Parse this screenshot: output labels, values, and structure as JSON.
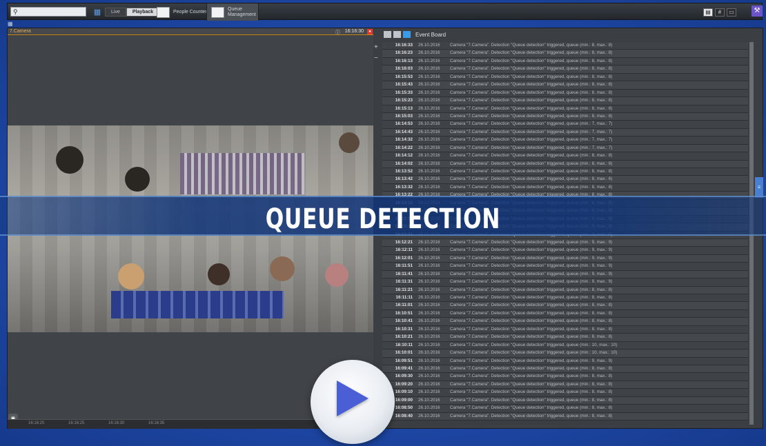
{
  "toolbar": {
    "search_placeholder": "",
    "mode_live": "Live",
    "mode_playback": "Playback",
    "people_counter": "People Counter",
    "queue_management": "Queue Management"
  },
  "camera": {
    "name": "7.Camera",
    "time": "16:16:30",
    "timeline_ticks": [
      "16:16:20",
      "16:16:25",
      "16:16:30",
      "16:16:35"
    ]
  },
  "event_board": {
    "title": "Event Board",
    "rows": [
      {
        "time": "16:16:33",
        "date": "26.10.2016",
        "message": "Camera \"7.Camera\". Detection \"Queue detection\" triggered, queue (min.: 8, max.: 8)"
      },
      {
        "time": "16:16:23",
        "date": "26.10.2016",
        "message": "Camera \"7.Camera\". Detection \"Queue detection\" triggered, queue (min.: 8, max.: 8)"
      },
      {
        "time": "16:16:13",
        "date": "26.10.2016",
        "message": "Camera \"7.Camera\". Detection \"Queue detection\" triggered, queue (min.: 8, max.: 8)"
      },
      {
        "time": "16:16:03",
        "date": "26.10.2016",
        "message": "Camera \"7.Camera\". Detection \"Queue detection\" triggered, queue (min.: 8, max.: 8)"
      },
      {
        "time": "16:15:53",
        "date": "26.10.2016",
        "message": "Camera \"7.Camera\". Detection \"Queue detection\" triggered, queue (min.: 8, max.: 8)"
      },
      {
        "time": "16:15:43",
        "date": "26.10.2016",
        "message": "Camera \"7.Camera\". Detection \"Queue detection\" triggered, queue (min.: 8, max.: 8)"
      },
      {
        "time": "16:15:33",
        "date": "26.10.2016",
        "message": "Camera \"7.Camera\". Detection \"Queue detection\" triggered, queue (min.: 8, max.: 8)"
      },
      {
        "time": "16:15:23",
        "date": "26.10.2016",
        "message": "Camera \"7.Camera\". Detection \"Queue detection\" triggered, queue (min.: 8, max.: 8)"
      },
      {
        "time": "16:15:13",
        "date": "26.10.2016",
        "message": "Camera \"7.Camera\". Detection \"Queue detection\" triggered, queue (min.: 8, max.: 8)"
      },
      {
        "time": "16:15:03",
        "date": "26.10.2016",
        "message": "Camera \"7.Camera\". Detection \"Queue detection\" triggered, queue (min.: 8, max.: 8)"
      },
      {
        "time": "16:14:53",
        "date": "26.10.2016",
        "message": "Camera \"7.Camera\". Detection \"Queue detection\" triggered, queue (min.: 7, max.: 7)"
      },
      {
        "time": "16:14:43",
        "date": "26.10.2016",
        "message": "Camera \"7.Camera\". Detection \"Queue detection\" triggered, queue (min.: 7, max.: 7)"
      },
      {
        "time": "16:14:32",
        "date": "26.10.2016",
        "message": "Camera \"7.Camera\". Detection \"Queue detection\" triggered, queue (min.: 7, max.: 7)"
      },
      {
        "time": "16:14:22",
        "date": "26.10.2016",
        "message": "Camera \"7.Camera\". Detection \"Queue detection\" triggered, queue (min.: 7, max.: 7)"
      },
      {
        "time": "16:14:12",
        "date": "26.10.2016",
        "message": "Camera \"7.Camera\". Detection \"Queue detection\" triggered, queue (min.: 8, max.: 8)"
      },
      {
        "time": "16:14:02",
        "date": "26.10.2016",
        "message": "Camera \"7.Camera\". Detection \"Queue detection\" triggered, queue (min.: 8, max.: 8)"
      },
      {
        "time": "16:13:52",
        "date": "26.10.2016",
        "message": "Camera \"7.Camera\". Detection \"Queue detection\" triggered, queue (min.: 8, max.: 8)"
      },
      {
        "time": "16:13:42",
        "date": "26.10.2016",
        "message": "Camera \"7.Camera\". Detection \"Queue detection\" triggered, queue (min.: 8, max.: 6)"
      },
      {
        "time": "16:13:32",
        "date": "26.10.2016",
        "message": "Camera \"7.Camera\". Detection \"Queue detection\" triggered, queue (min.: 8, max.: 8)"
      },
      {
        "time": "16:13:22",
        "date": "26.10.2016",
        "message": "Camera \"7.Camera\". Detection \"Queue detection\" triggered, queue (min.: 8, max.: 8)"
      },
      {
        "time": "16:13:12",
        "date": "26.10.2016",
        "message": "Camera \"7.Camera\". Detection \"Queue detection\" triggered, queue (min.: 8, max.: 8)"
      },
      {
        "time": "16:13:02",
        "date": "26.10.2016",
        "message": "Camera \"7.Camera\". Detection \"Queue detection\" triggered, queue (min.: 8, max.: 8)"
      },
      {
        "time": "16:12:51",
        "date": "26.10.2016",
        "message": "Camera \"7.Camera\". Detection \"Queue detection\" triggered, queue (min.: 8, max.: 8)"
      },
      {
        "time": "16:12:41",
        "date": "26.10.2016",
        "message": "Camera \"7.Camera\". Detection \"Queue detection\" triggered, queue (min.: 9, max.: 9)"
      },
      {
        "time": "16:12:31",
        "date": "26.10.2016",
        "message": "Camera \"7.Camera\". Detection \"Queue detection\" triggered, queue (min.: 9, max.: 9)"
      },
      {
        "time": "16:12:21",
        "date": "26.10.2016",
        "message": "Camera \"7.Camera\". Detection \"Queue detection\" triggered, queue (min.: 9, max.: 9)"
      },
      {
        "time": "16:12:11",
        "date": "26.10.2016",
        "message": "Camera \"7.Camera\". Detection \"Queue detection\" triggered, queue (min.: 9, max.: 9)"
      },
      {
        "time": "16:12:01",
        "date": "26.10.2016",
        "message": "Camera \"7.Camera\". Detection \"Queue detection\" triggered, queue (min.: 9, max.: 9)"
      },
      {
        "time": "16:11:51",
        "date": "26.10.2016",
        "message": "Camera \"7.Camera\". Detection \"Queue detection\" triggered, queue (min.: 9, max.: 9)"
      },
      {
        "time": "16:11:41",
        "date": "26.10.2016",
        "message": "Camera \"7.Camera\". Detection \"Queue detection\" triggered, queue (min.: 9, max.: 9)"
      },
      {
        "time": "16:11:31",
        "date": "26.10.2016",
        "message": "Camera \"7.Camera\". Detection \"Queue detection\" triggered, queue (min.: 9, max.: 9)"
      },
      {
        "time": "16:11:21",
        "date": "26.10.2016",
        "message": "Camera \"7.Camera\". Detection \"Queue detection\" triggered, queue (min.: 8, max.: 8)"
      },
      {
        "time": "16:11:11",
        "date": "26.10.2016",
        "message": "Camera \"7.Camera\". Detection \"Queue detection\" triggered, queue (min.: 8, max.: 8)"
      },
      {
        "time": "16:11:01",
        "date": "26.10.2016",
        "message": "Camera \"7.Camera\". Detection \"Queue detection\" triggered, queue (min.: 8, max.: 8)"
      },
      {
        "time": "16:10:51",
        "date": "26.10.2016",
        "message": "Camera \"7.Camera\". Detection \"Queue detection\" triggered, queue (min.: 8, max.: 8)"
      },
      {
        "time": "16:10:41",
        "date": "26.10.2016",
        "message": "Camera \"7.Camera\". Detection \"Queue detection\" triggered, queue (min.: 8, max.: 8)"
      },
      {
        "time": "16:10:31",
        "date": "26.10.2016",
        "message": "Camera \"7.Camera\". Detection \"Queue detection\" triggered, queue (min.: 8, max.: 8)"
      },
      {
        "time": "16:10:21",
        "date": "26.10.2016",
        "message": "Camera \"7.Camera\". Detection \"Queue detection\" triggered, queue (min.: 8, max.: 8)"
      },
      {
        "time": "16:10:11",
        "date": "26.10.2016",
        "message": "Camera \"7.Camera\". Detection \"Queue detection\" triggered, queue (min.: 10, max.: 10)"
      },
      {
        "time": "16:10:01",
        "date": "26.10.2016",
        "message": "Camera \"7.Camera\". Detection \"Queue detection\" triggered, queue (min.: 10, max.: 10)"
      },
      {
        "time": "16:09:51",
        "date": "26.10.2016",
        "message": "Camera \"7.Camera\". Detection \"Queue detection\" triggered, queue (min.: 9, max.: 9)"
      },
      {
        "time": "16:09:41",
        "date": "26.10.2016",
        "message": "Camera \"7.Camera\". Detection \"Queue detection\" triggered, queue (min.: 8, max.: 8)"
      },
      {
        "time": "16:09:30",
        "date": "26.10.2016",
        "message": "Camera \"7.Camera\". Detection \"Queue detection\" triggered, queue (min.: 8, max.: 8)"
      },
      {
        "time": "16:09:20",
        "date": "26.10.2016",
        "message": "Camera \"7.Camera\". Detection \"Queue detection\" triggered, queue (min.: 8, max.: 8)"
      },
      {
        "time": "16:09:10",
        "date": "26.10.2016",
        "message": "Camera \"7.Camera\". Detection \"Queue detection\" triggered, queue (min.: 8, max.: 8)"
      },
      {
        "time": "16:09:00",
        "date": "26.10.2016",
        "message": "Camera \"7.Camera\". Detection \"Queue detection\" triggered, queue (min.: 8, max.: 8)"
      },
      {
        "time": "16:08:50",
        "date": "26.10.2016",
        "message": "Camera \"7.Camera\". Detection \"Queue detection\" triggered, queue (min.: 8, max.: 8)"
      },
      {
        "time": "16:08:40",
        "date": "26.10.2016",
        "message": "Camera \"7.Camera\". Detection \"Queue detection\" triggered, queue (min.: 8, max.: 8)"
      }
    ]
  },
  "banner": {
    "text": "QUEUE DETECTION"
  },
  "colors": {
    "background": "#2250b0",
    "accent": "#4a5fd6",
    "alarm": "#e0392f",
    "camera_title": "#e6b15a"
  }
}
